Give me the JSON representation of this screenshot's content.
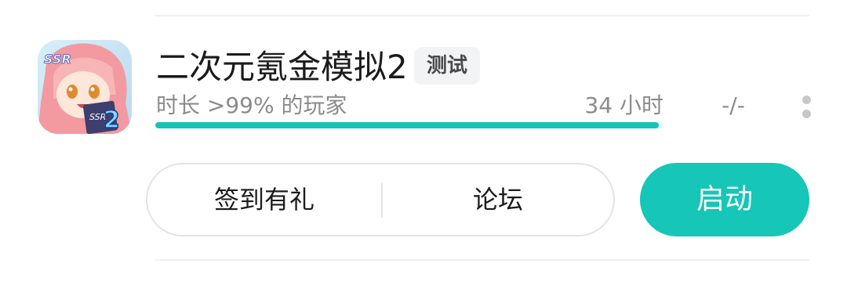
{
  "app": {
    "title": "二次元氪金模拟2",
    "tag": "测试",
    "stat_label": "时长 >99% 的玩家",
    "play_time": "34 小时",
    "playtime_percentile": 0.99,
    "rating": "-/-",
    "icon": "anime-ssr-card-icon",
    "icon_text": "SSR",
    "icon_number": "2"
  },
  "actions": {
    "checkin_label": "签到有礼",
    "forum_label": "论坛",
    "launch_label": "启动"
  },
  "colors": {
    "accent": "#16c6b7",
    "progress": "#16c2b4",
    "muted_text": "#8b8b8b"
  }
}
